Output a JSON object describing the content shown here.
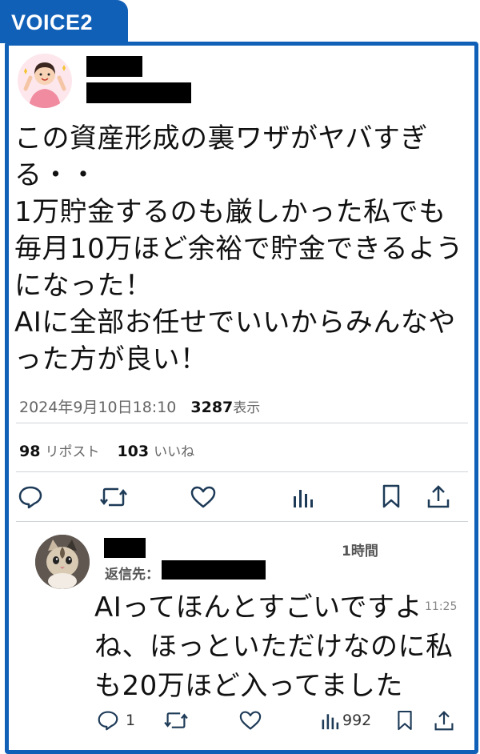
{
  "badge": {
    "label": "VOICE2"
  },
  "post": {
    "text": "この資産形成の裏ワザがヤバすぎる・・\n1万貯金するのも厳しかった私でも毎月10万ほど余裕で貯金できるようになった！\nAIに全部お任せでいいからみんなやった方が良い！",
    "timestamp": "2024年9月10日18:10",
    "views_count": "3287",
    "views_label": "表示",
    "reposts_count": "98",
    "reposts_label": "リポスト",
    "likes_count": "103",
    "likes_label": "いいね"
  },
  "reply": {
    "time": "1時間",
    "reply_to_label": "返信先：",
    "text": "AIってほんとすごいですよね、ほっといただけなのに私も20万ほど入ってました",
    "stamp": "11:25",
    "reply_count": "1",
    "views_count": "992"
  },
  "colors": {
    "accent": "#1160b8",
    "icon": "#1d3a57"
  }
}
